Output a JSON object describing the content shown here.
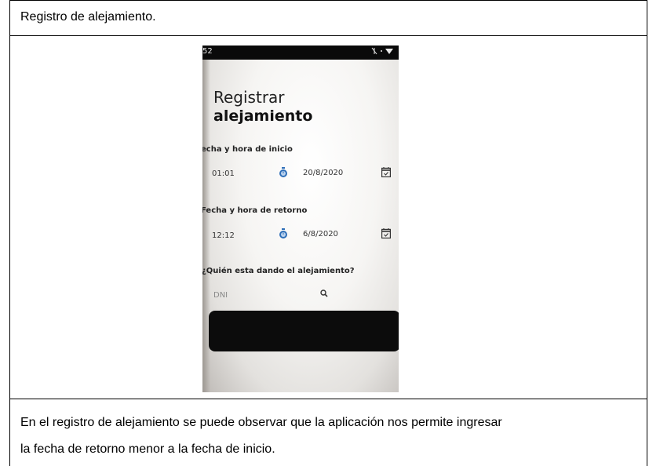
{
  "document": {
    "header_text": "Registro de alejamiento.",
    "description_line1": "En el registro de alejamiento se puede observar que la aplicación nos permite ingresar",
    "description_line2": "la fecha de retorno menor a la fecha de inicio."
  },
  "phone": {
    "status_time": "52",
    "status_icons": "ᾶ • ▾",
    "title_line1": "Registrar",
    "title_line2": "alejamiento",
    "start_label": "echa y hora de inicio",
    "start_time": "01:01",
    "start_date": "20/8/2020",
    "return_label": "Fecha y hora de retorno",
    "return_time": "12:12",
    "return_date": "6/8/2020",
    "who_label": "¿Quién esta dando el alejamiento?",
    "dni_placeholder": "DNI",
    "icons": {
      "start_time_icon": "stopwatch-icon",
      "start_date_icon": "calendar-icon",
      "return_time_icon": "stopwatch-icon",
      "return_date_icon": "calendar-icon",
      "search_icon": "search-icon"
    },
    "accent_color": "#2f6fb8"
  }
}
